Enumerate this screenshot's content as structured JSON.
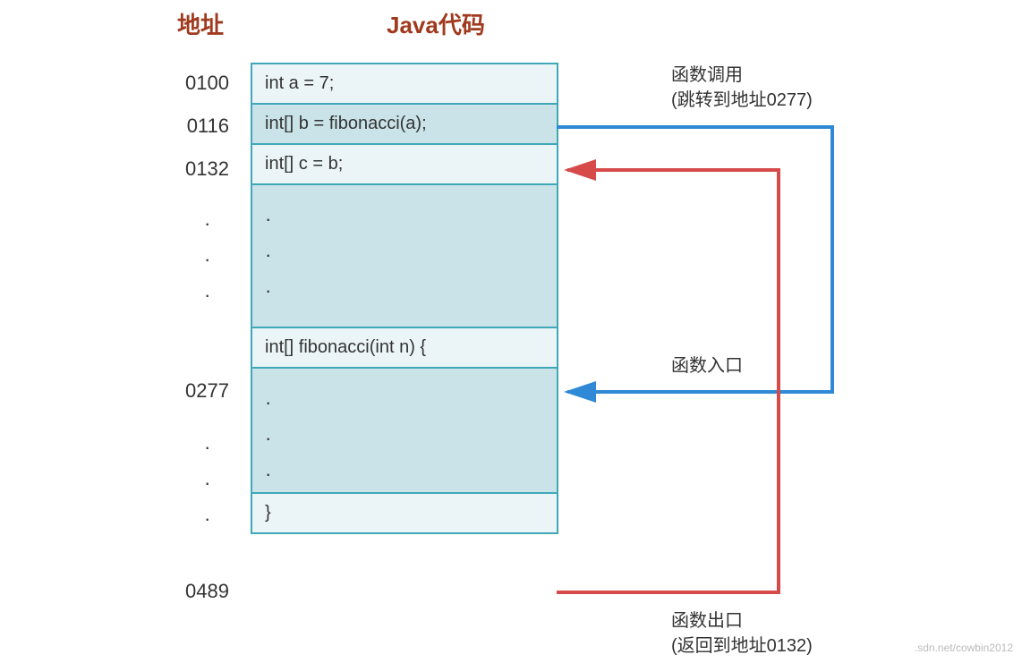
{
  "headers": {
    "addr": "地址",
    "code": "Java代码"
  },
  "rows": [
    {
      "addr": "0100",
      "code": "int a = 7;",
      "style": "light"
    },
    {
      "addr": "0116",
      "code": "int[] b = fibonacci(a);",
      "style": "dark"
    },
    {
      "addr": "0132",
      "code": "int[] c = b;",
      "style": "light"
    },
    {
      "addr": "0277",
      "code": "int[] fibonacci(int n) {",
      "style": "light"
    },
    {
      "addr": "0489",
      "code": "}",
      "style": "light"
    }
  ],
  "annotations": {
    "call": {
      "line1": "函数调用",
      "line2": "(跳转到地址0277)"
    },
    "entry": {
      "line1": "函数入口"
    },
    "exit": {
      "line1": "函数出口",
      "line2": "(返回到地址0132)"
    }
  },
  "watermark": ".sdn.net/cowbin2012",
  "colors": {
    "blue": "#2f89d6",
    "red": "#d64a4a"
  }
}
